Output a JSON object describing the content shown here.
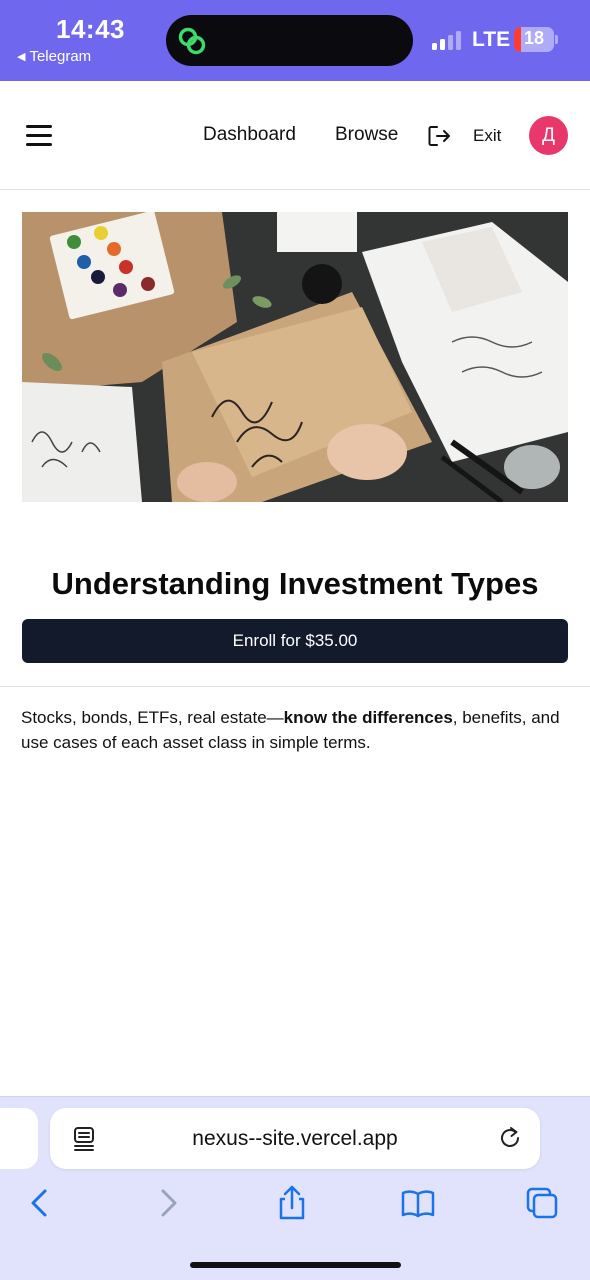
{
  "status_bar": {
    "time": "14:43",
    "back_app": "Telegram",
    "back_icon": "back-triangle-icon",
    "network": "LTE",
    "battery": "18",
    "battery_level": 0.18,
    "background_color": "#6f67ee",
    "island_icon": "link-rings-icon"
  },
  "header": {
    "menu_icon": "hamburger-menu-icon",
    "nav": {
      "dashboard": "Dashboard",
      "browse": "Browse"
    },
    "exit_icon": "exit-arrow-icon",
    "exit_label": "Exit",
    "avatar_initial": "Д",
    "avatar_color": "#e8386b"
  },
  "course": {
    "hero_image": "hand-lettering-desk-photo",
    "title": "Understanding Investment Types",
    "enroll_label": "Enroll for $35.00",
    "enroll_color": "#121a2b",
    "description": {
      "before": "Stocks, bonds, ETFs, real estate—",
      "bold": "know the differences",
      "after": ", benefits, and use cases of each asset class in simple terms."
    }
  },
  "safari": {
    "url": "nexus--site.vercel.app",
    "reader_icon": "page-menu-icon",
    "reload_icon": "reload-icon",
    "toolbar": [
      "back-chevron-icon",
      "forward-chevron-icon",
      "share-icon",
      "bookmarks-icon",
      "tabs-icon"
    ],
    "bar_color": "#e1e3fc",
    "accent_color": "#1a73e8"
  }
}
